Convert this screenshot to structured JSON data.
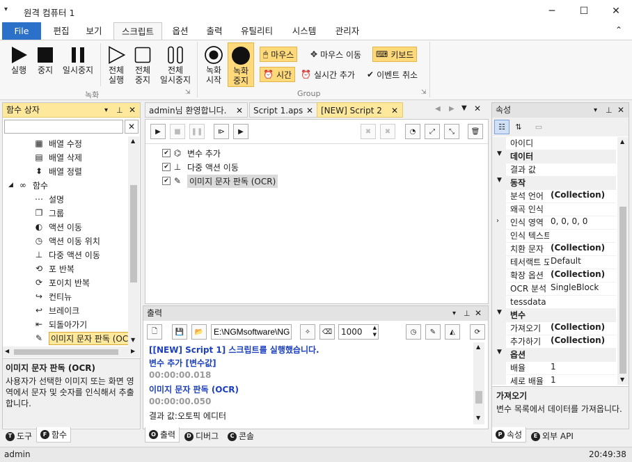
{
  "window": {
    "title": "원격 컴퓨터 1",
    "sysmenu_glyph": "▾",
    "minimize": "─",
    "maximize": "☐",
    "close": "✕"
  },
  "ribbon_tabs": {
    "file": "File",
    "items": [
      "편집",
      "보기",
      "스크립트",
      "옵션",
      "출력",
      "유틸리티",
      "시스템",
      "관리자"
    ],
    "active_index": 2,
    "collapse_glyph": "⌃"
  },
  "ribbon": {
    "rec_group": {
      "label": "녹화",
      "run": "실행",
      "stop": "중지",
      "pause": "일시중지",
      "run_all_1": "전체",
      "run_all_2": "실행",
      "stop_all_1": "전체",
      "stop_all_2": "중지",
      "pause_all_1": "전체",
      "pause_all_2": "일시중지"
    },
    "group2": {
      "label": "Group",
      "rec_start_1": "녹화",
      "rec_start_2": "시작",
      "rec_stop_1": "녹화",
      "rec_stop_2": "중지",
      "mouse": "마우스",
      "mouse_move": "마우스 이동",
      "keyboard": "키보드",
      "time": "시간",
      "realtime_add": "실시간 추가",
      "event_cancel": "이벤트 취소"
    },
    "launcher_glyph": "⇲"
  },
  "left_panel": {
    "title": "함수 상자",
    "pin_glyph": "▾",
    "search_placeholder": "",
    "clear_glyph": "✕",
    "items": [
      {
        "label": "배열 수정",
        "icon": "array-edit-icon",
        "glyph": "▦",
        "indent": 1
      },
      {
        "label": "배열 삭제",
        "icon": "array-delete-icon",
        "glyph": "▤",
        "indent": 1
      },
      {
        "label": "배열 정렬",
        "icon": "array-sort-icon",
        "glyph": "⬍",
        "indent": 1
      },
      {
        "label": "함수",
        "icon": "function-folder-icon",
        "glyph": "∞",
        "indent": 0
      },
      {
        "label": "설명",
        "icon": "description-icon",
        "glyph": "⋯",
        "indent": 1
      },
      {
        "label": "그룹",
        "icon": "group-icon",
        "glyph": "❐",
        "indent": 1
      },
      {
        "label": "액션 이동",
        "icon": "action-move-icon",
        "glyph": "◐",
        "indent": 1
      },
      {
        "label": "액션 이동 위치",
        "icon": "action-move-position-icon",
        "glyph": "◷",
        "indent": 1
      },
      {
        "label": "다중 액션 이동",
        "icon": "multi-action-move-icon",
        "glyph": "⊥",
        "indent": 1
      },
      {
        "label": "포 반복",
        "icon": "for-loop-icon",
        "glyph": "⟲",
        "indent": 1
      },
      {
        "label": "포이치 반복",
        "icon": "foreach-loop-icon",
        "glyph": "⟳",
        "indent": 1
      },
      {
        "label": "컨티뉴",
        "icon": "continue-icon",
        "glyph": "↪",
        "indent": 1
      },
      {
        "label": "브레이크",
        "icon": "break-icon",
        "glyph": "↩",
        "indent": 1
      },
      {
        "label": "되돌아가기",
        "icon": "return-icon",
        "glyph": "⇤",
        "indent": 1
      },
      {
        "label": "이미지 문자 판독 (OCR)",
        "icon": "ocr-icon",
        "glyph": "✎",
        "indent": 1,
        "selected": true
      }
    ],
    "desc_title": "이미지 문자 판독 (OCR)",
    "desc_body": "사용자가 선택한 이미지 또는 화면 영역에서 문자 및 숫자를 인식해서 추출합니다.",
    "tab_tools": "도구",
    "tab_functions": "함수"
  },
  "doc_tabs": {
    "items": [
      {
        "label": "admin님 환영합니다."
      },
      {
        "label": "Script 1.aps"
      },
      {
        "label": "[NEW] Script 2"
      }
    ],
    "active_index": 2
  },
  "script_tree": {
    "items": [
      {
        "label": "변수 추가",
        "icon": "variable-add-icon",
        "glyph": "⌬"
      },
      {
        "label": "다중 액션 이동",
        "icon": "multi-action-move-icon",
        "glyph": "⊥"
      },
      {
        "label": "이미지 문자 판독 (OCR)",
        "icon": "ocr-icon",
        "glyph": "✎"
      }
    ],
    "check_glyph": "✔"
  },
  "output": {
    "title": "출력",
    "path": "E:\\NGMsoftware\\NG",
    "count": "1000",
    "lines": [
      {
        "text": "[[NEW] Script 1] 스크립트를 실행했습니다.",
        "style": "blue"
      },
      {
        "text": "변수 추가 [변수값]",
        "style": "blue"
      },
      {
        "text": "00:00:00.018",
        "style": "grey"
      },
      {
        "text": "이미지 문자 판독 (OCR)",
        "style": "blue"
      },
      {
        "text": "00:00:00.050",
        "style": "grey"
      },
      {
        "text": "결과 값:오토픽 에디터",
        "style": "plain"
      }
    ],
    "tab_output": "출력",
    "tab_debug": "디버그",
    "tab_console": "콘솔"
  },
  "properties": {
    "title": "속성",
    "rows": [
      {
        "kind": "row",
        "key": "아이디",
        "value": ""
      },
      {
        "kind": "cat",
        "key": "데이터"
      },
      {
        "kind": "row",
        "key": "결과 값",
        "value": ""
      },
      {
        "kind": "cat",
        "key": "동작"
      },
      {
        "kind": "row",
        "key": "분석 언어",
        "value": "(Collection)",
        "bold": true
      },
      {
        "kind": "row",
        "key": "왜곡 인식",
        "value": ""
      },
      {
        "kind": "row",
        "key": "인식 영역",
        "value": "0, 0, 0, 0",
        "expand": true
      },
      {
        "kind": "row",
        "key": "인식 텍스트",
        "value": ""
      },
      {
        "kind": "row",
        "key": "치환 문자",
        "value": "(Collection)",
        "bold": true
      },
      {
        "kind": "row",
        "key": "테서랙트 모드",
        "value": "Default"
      },
      {
        "kind": "row",
        "key": "확장 옵션",
        "value": "(Collection)",
        "bold": true
      },
      {
        "kind": "row",
        "key": "OCR 분석",
        "value": "SingleBlock"
      },
      {
        "kind": "row",
        "key": "tessdata 폴더",
        "value": ""
      },
      {
        "kind": "cat",
        "key": "변수"
      },
      {
        "kind": "row",
        "key": "가져오기",
        "value": "(Collection)",
        "bold": true
      },
      {
        "kind": "row",
        "key": "추가하기",
        "value": "(Collection)",
        "bold": true
      },
      {
        "kind": "cat",
        "key": "옵션"
      },
      {
        "kind": "row",
        "key": "배율",
        "value": "1"
      },
      {
        "kind": "row",
        "key": "세로 배율",
        "value": "1"
      }
    ],
    "desc_title": "가져오기",
    "desc_body": "변수 목록에서 데이터를 가져옵니다.",
    "tab_props": "속성",
    "tab_api": "외부 API"
  },
  "status": {
    "user": "admin",
    "time": "20:49:38"
  }
}
